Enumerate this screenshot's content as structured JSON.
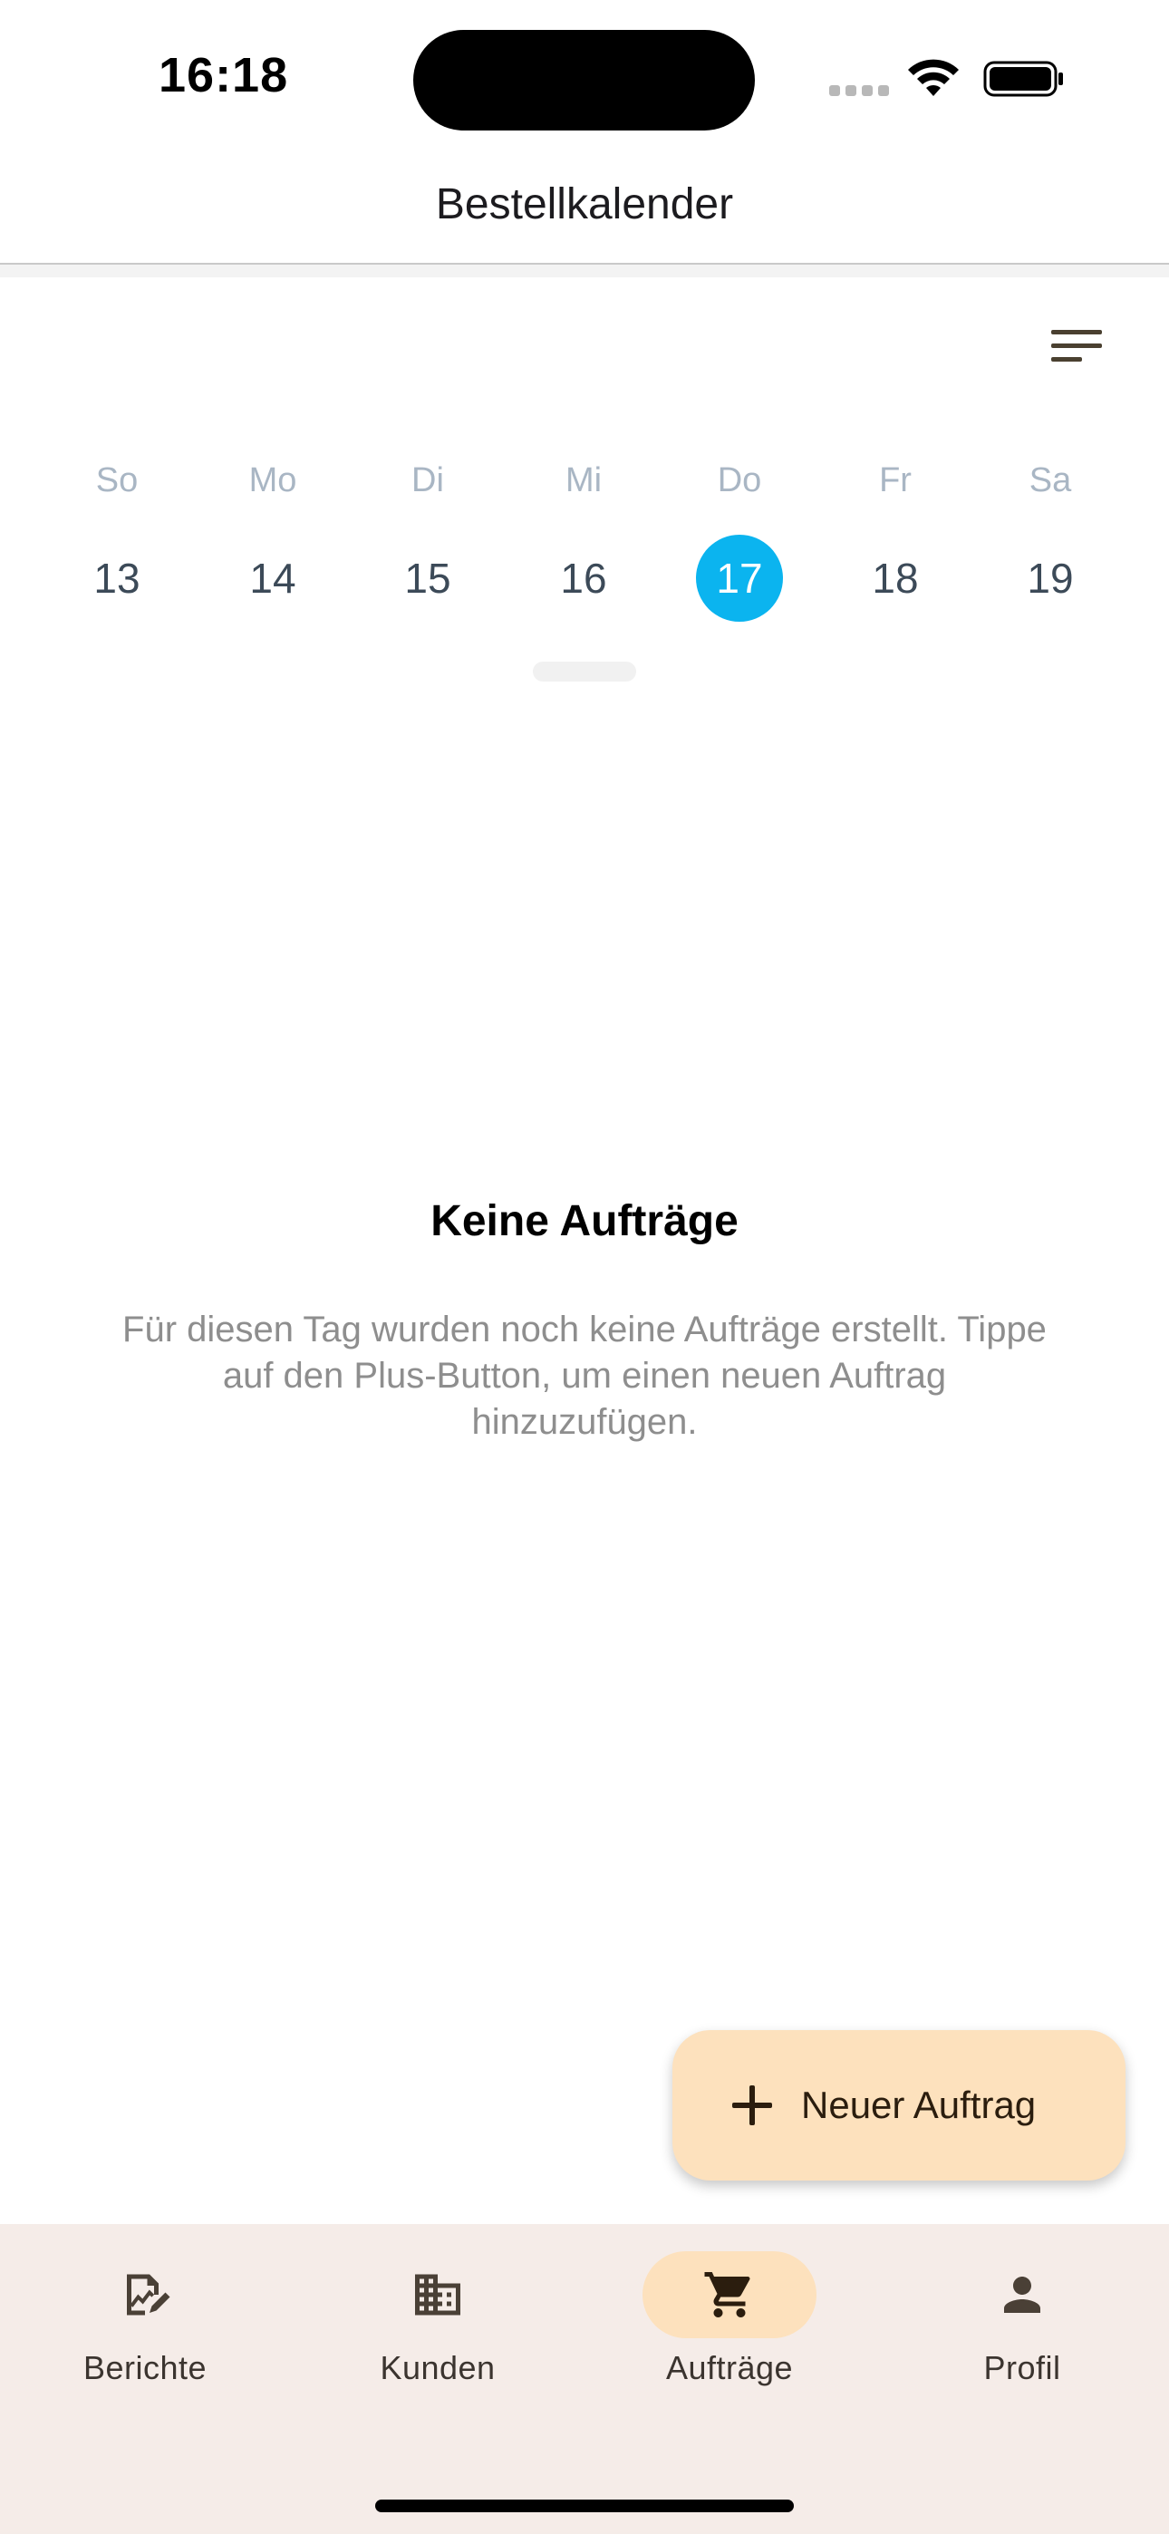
{
  "status_bar": {
    "time": "16:18"
  },
  "app_bar": {
    "title": "Bestellkalender"
  },
  "toolbar": {
    "filter_icon": "filter-list-icon"
  },
  "calendar": {
    "days": [
      {
        "name": "So",
        "number": "13",
        "selected": false
      },
      {
        "name": "Mo",
        "number": "14",
        "selected": false
      },
      {
        "name": "Di",
        "number": "15",
        "selected": false
      },
      {
        "name": "Mi",
        "number": "16",
        "selected": false
      },
      {
        "name": "Do",
        "number": "17",
        "selected": true
      },
      {
        "name": "Fr",
        "number": "18",
        "selected": false
      },
      {
        "name": "Sa",
        "number": "19",
        "selected": false
      }
    ],
    "selected_color": "#0bb4ef"
  },
  "empty_state": {
    "title": "Keine Aufträge",
    "text": "Für diesen Tag wurden noch keine Aufträge erstellt. Tippe auf den Plus-Button, um einen neuen Auftrag hinzuzufügen."
  },
  "fab": {
    "label": "Neuer Auftrag",
    "icon": "plus-icon",
    "color": "#fde1bd"
  },
  "bottom_nav": {
    "items": [
      {
        "label": "Berichte",
        "icon": "report-edit-icon",
        "active": false
      },
      {
        "label": "Kunden",
        "icon": "building-icon",
        "active": false
      },
      {
        "label": "Aufträge",
        "icon": "shopping-cart-icon",
        "active": true
      },
      {
        "label": "Profil",
        "icon": "person-icon",
        "active": false
      }
    ]
  }
}
